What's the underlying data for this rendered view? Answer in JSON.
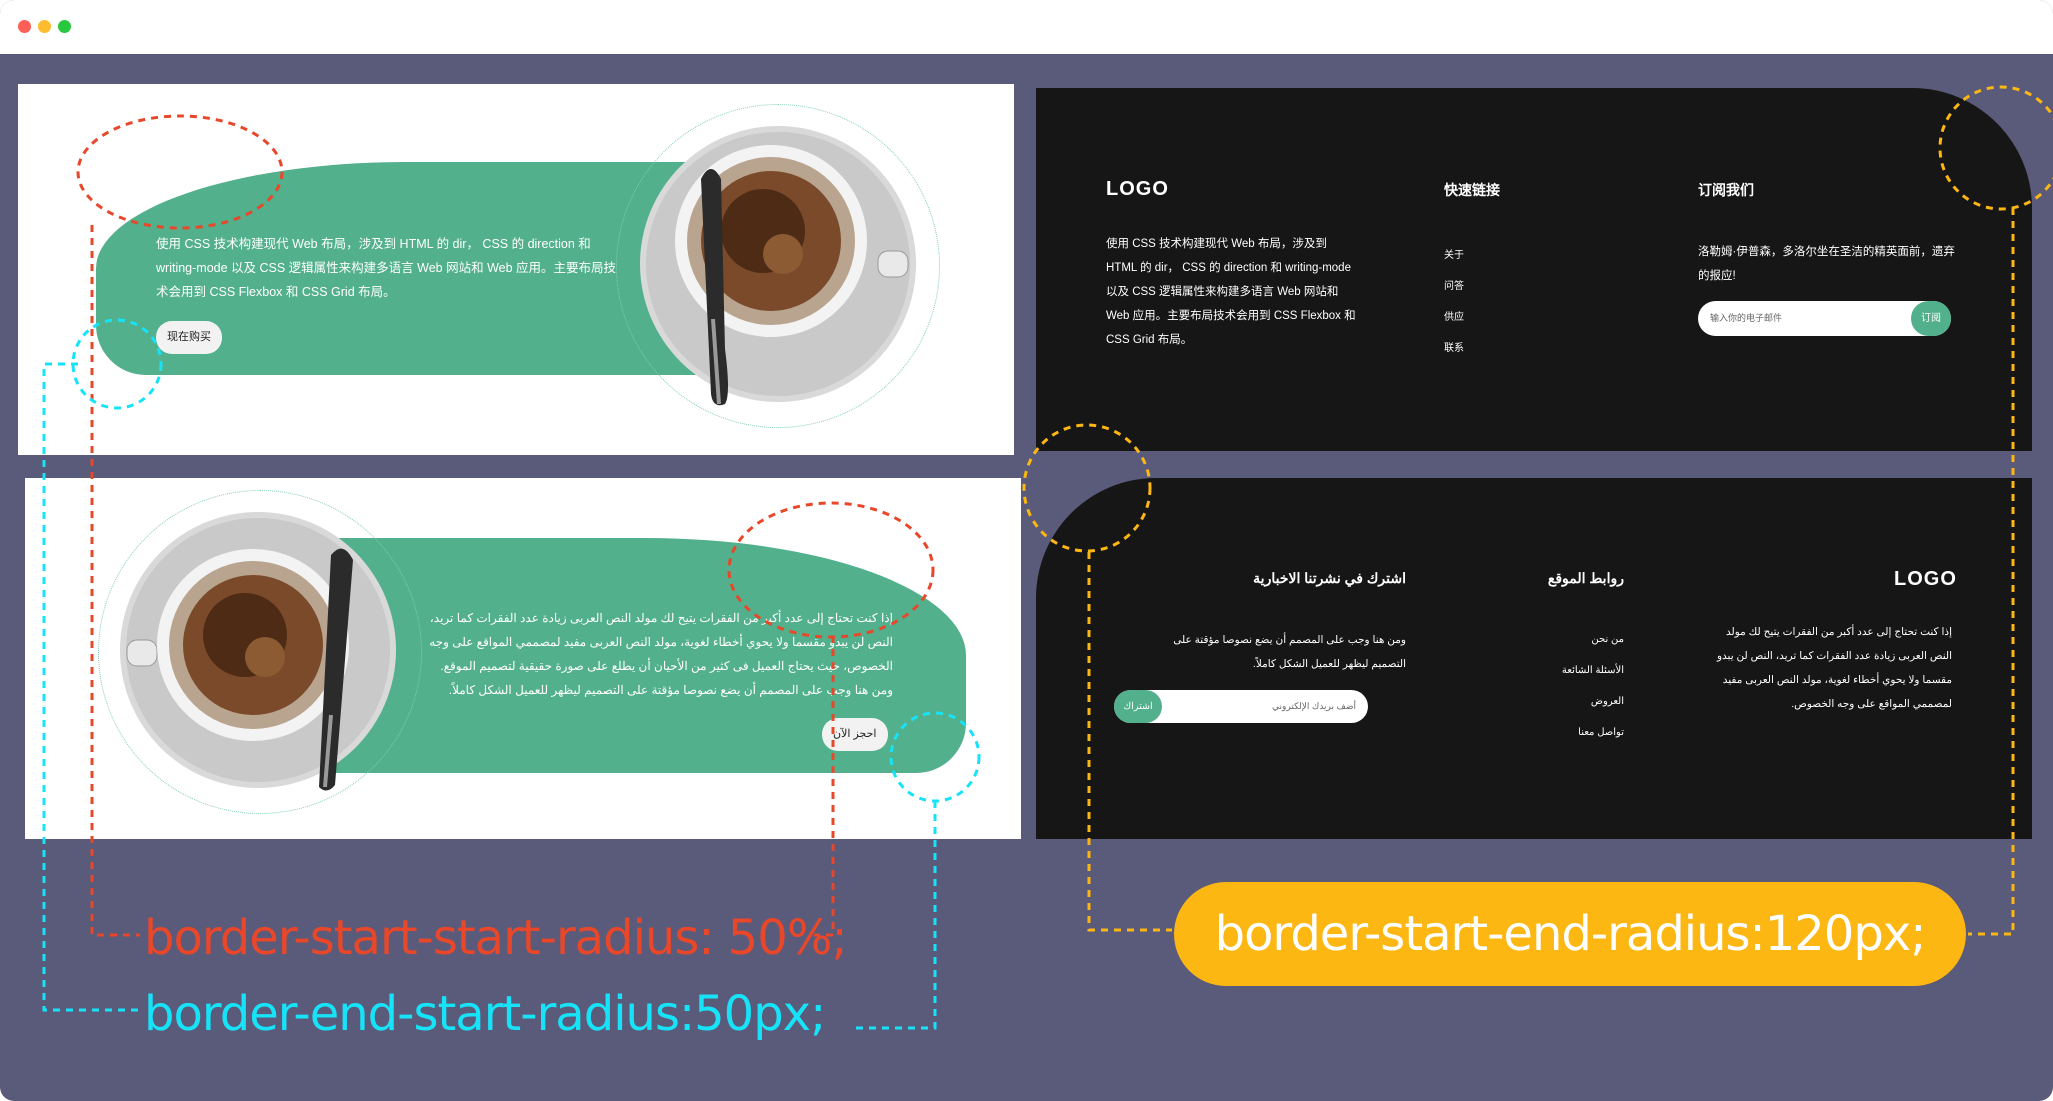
{
  "window": {
    "controls": [
      "close",
      "minimize",
      "zoom"
    ]
  },
  "hero_ltr": {
    "text": "使用 CSS 技术构建现代 Web 布局，涉及到 HTML 的 dir， CSS 的 direction 和 writing-mode 以及 CSS 逻辑属性来构建多语言 Web 网站和 Web 应用。主要布局技术会用到 CSS Flexbox 和 CSS Grid 布局。",
    "button": "现在购买"
  },
  "hero_rtl": {
    "text": "إذا كنت تحتاج إلى عدد أكبر من الفقرات يتيح لك مولد النص العربى زيادة عدد الفقرات كما تريد، النص لن يبدو مقسما ولا يحوي أخطاء لغوية، مولد النص العربى مفيد لمصممي المواقع على وجه الخصوص، حيث يحتاج العميل فى كثير من الأحيان أن يطلع على صورة حقيقية لتصميم الموقع. ومن هنا وجب على المصمم أن يضع نصوصا مؤقتة على التصميم ليظهر للعميل الشكل كاملاً.",
    "button": "احجز الآن"
  },
  "footer_ltr": {
    "logo": "LOGO",
    "intro": "使用 CSS 技术构建现代 Web 布局，涉及到 HTML 的 dir， CSS 的 direction 和 writing-mode 以及 CSS 逻辑属性来构建多语言 Web 网站和 Web 应用。主要布局技术会用到 CSS Flexbox 和 CSS Grid 布局。",
    "links_title": "快速链接",
    "links": [
      "关于",
      "问答",
      "供应",
      "联系"
    ],
    "subscribe_title": "订阅我们",
    "subscribe_text": "洛勒姆·伊普森，多洛尔坐在圣洁的精英面前，遗弃的报应!",
    "input_placeholder": "输入你的电子邮件",
    "subscribe_button": "订阅"
  },
  "footer_rtl": {
    "logo": "LOGO",
    "intro": "إذا كنت تحتاج إلى عدد أكبر من الفقرات يتيح لك مولد النص العربى زيادة عدد الفقرات كما تريد، النص لن يبدو مقسما ولا يحوي أخطاء لغوية، مولد النص العربى مفيد لمصممي المواقع على وجه الخصوص.",
    "links_title": "روابط الموقع",
    "links": [
      "من نحن",
      "الأسئلة الشائعة",
      "العروض",
      "تواصل معنا"
    ],
    "subscribe_title": "اشترك في نشرتنا الاخبارية",
    "subscribe_text": "ومن هنا وجب على المصمم أن يضع نصوصا مؤقتة على التصميم ليظهر للعميل الشكل كاملاً.",
    "input_placeholder": "أضف بريدك الإلكتروني",
    "subscribe_button": "اشتراك"
  },
  "annotations": {
    "red": "border-start-start-radius: 50%;",
    "cyan": "border-end-start-radius:50px;",
    "yellow": "border-start-end-radius:120px;"
  },
  "colors": {
    "window_bg": "#5a5a7a",
    "hero_green": "#52b08c",
    "footer_dark": "#161616",
    "red": "#e8472a",
    "cyan": "#17e3f8",
    "yellow": "#fcb713"
  }
}
